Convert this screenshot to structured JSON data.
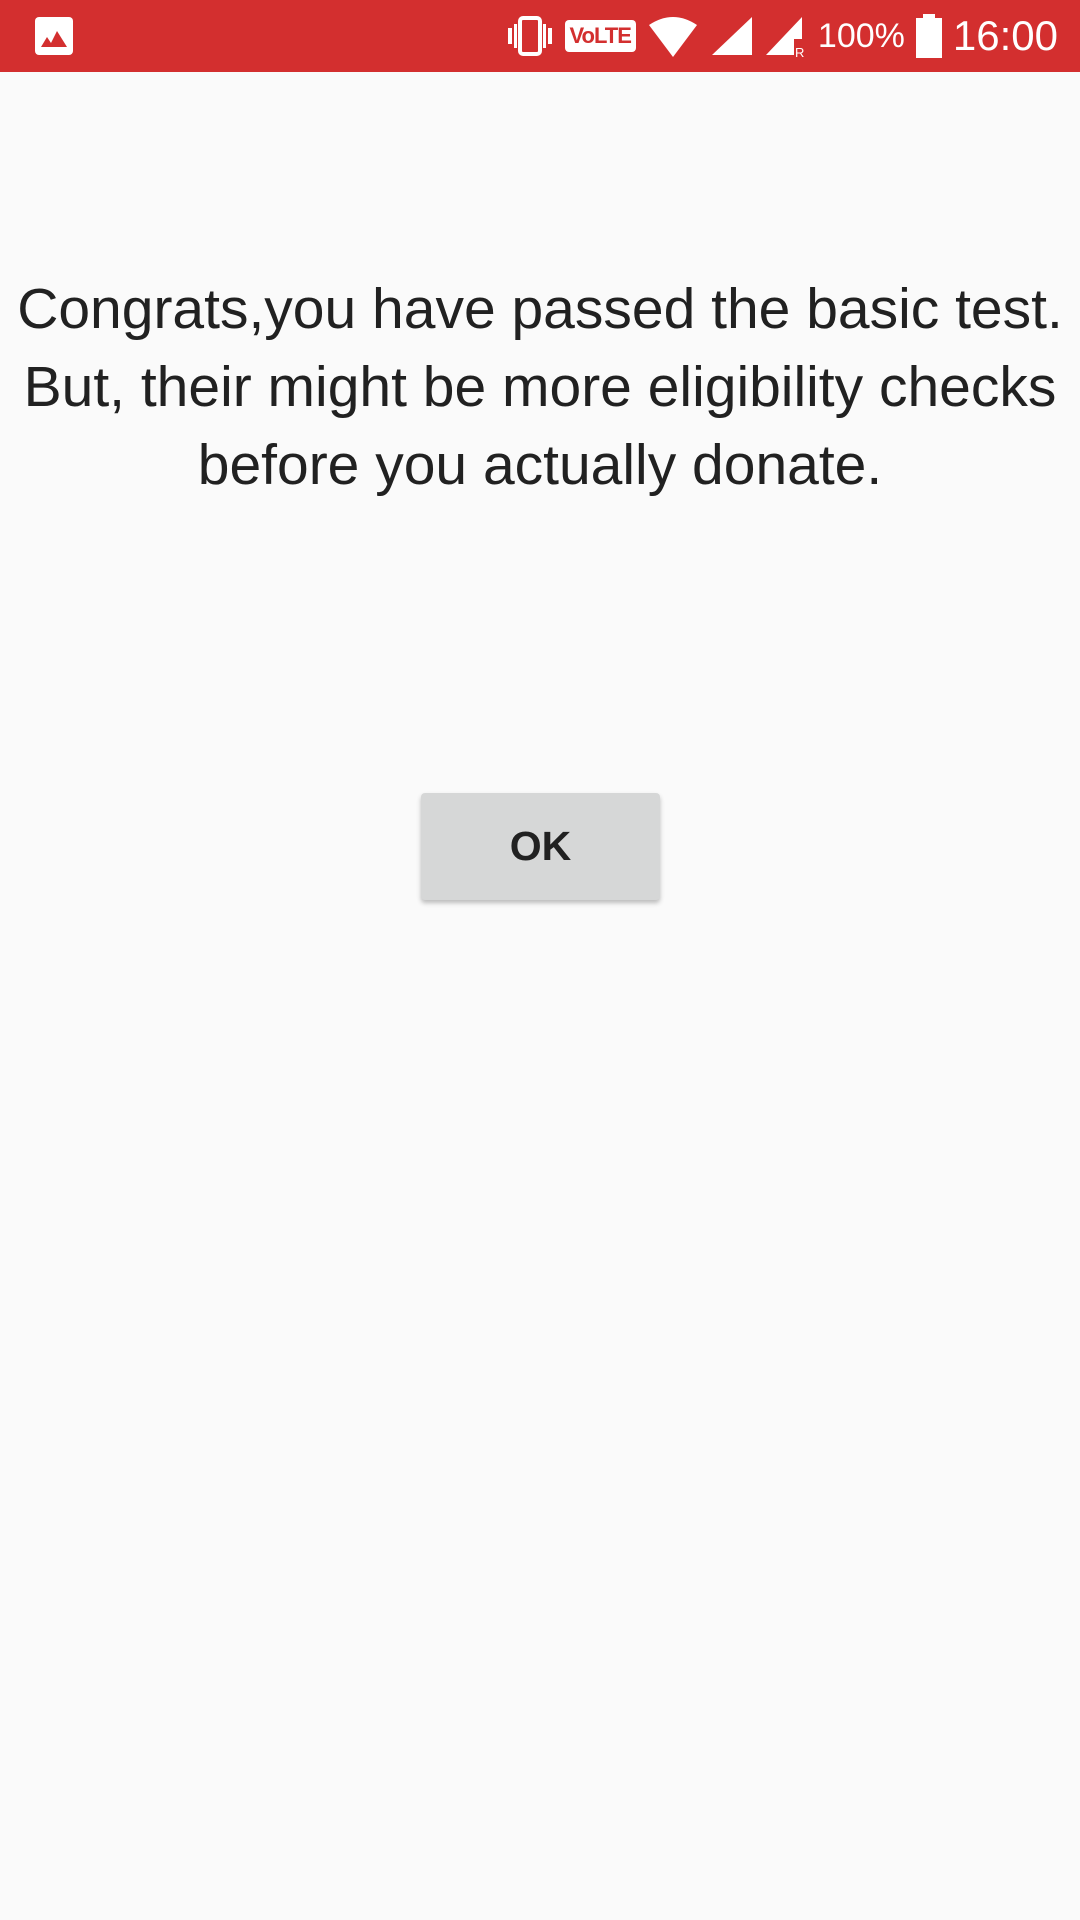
{
  "status_bar": {
    "background_color": "#d32f2f",
    "notification_icon": "gallery-icon",
    "volte_label": "VoLTE",
    "battery_percent": "100%",
    "time": "16:00"
  },
  "message": {
    "text": "Congrats,you have passed the basic test.\n But, their might be more eligibility checks before you actually donate."
  },
  "ok_button": {
    "label": "OK"
  }
}
